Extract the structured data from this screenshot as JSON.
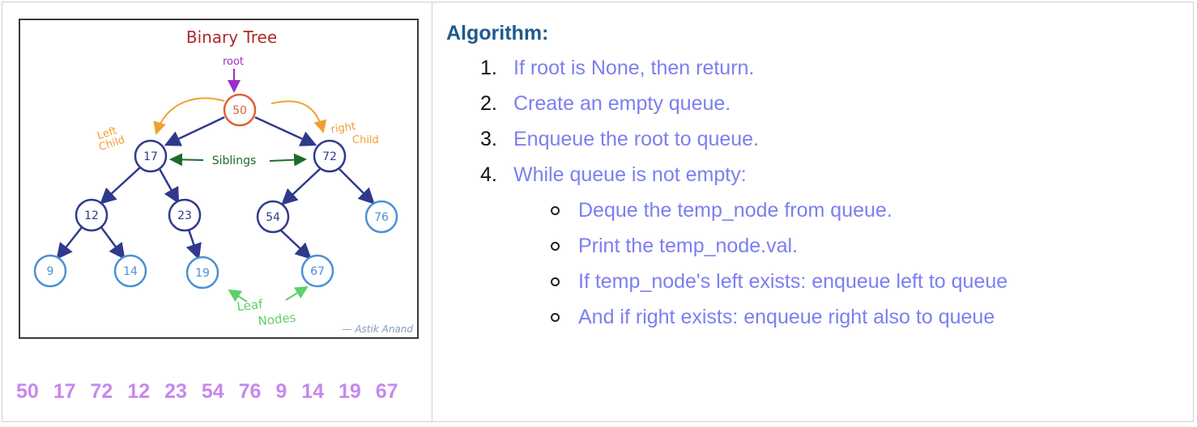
{
  "diagram": {
    "title": "Binary Tree",
    "root_label": "root",
    "left_child_label": [
      "Left",
      "Child"
    ],
    "right_child_label": [
      "right",
      "Child"
    ],
    "siblings_label": "Siblings",
    "leaf_label": [
      "Leaf",
      "Nodes"
    ],
    "signature": "— Astik Anand",
    "nodes": [
      "50",
      "17",
      "72",
      "12",
      "23",
      "54",
      "76",
      "9",
      "14",
      "19",
      "67"
    ],
    "colors": {
      "title": "#b02a2a",
      "root_annotation": "#9b30c8",
      "root_node": "#e0603a",
      "internal_node": "#2f3a8c",
      "leaf_node": "#4a90d6",
      "child_annotation": "#f0a030",
      "siblings": "#1e6b2e",
      "leaf_annotation": "#5fcf6a"
    }
  },
  "traversal_order": [
    "50",
    "17",
    "72",
    "12",
    "23",
    "54",
    "76",
    "9",
    "14",
    "19",
    "67"
  ],
  "algorithm": {
    "title": "Algorithm:",
    "steps": [
      {
        "num": "1.",
        "text": "If root is None, then return."
      },
      {
        "num": "2.",
        "text": "Create an empty queue."
      },
      {
        "num": "3.",
        "text": "Enqueue the root to queue."
      },
      {
        "num": "4.",
        "text": "While queue is not empty:"
      }
    ],
    "substeps": [
      "Deque the temp_node from queue.",
      "Print the temp_node.val.",
      "If temp_node's left exists: enqueue left to queue",
      "And if right exists: enqueue right also to queue"
    ]
  }
}
